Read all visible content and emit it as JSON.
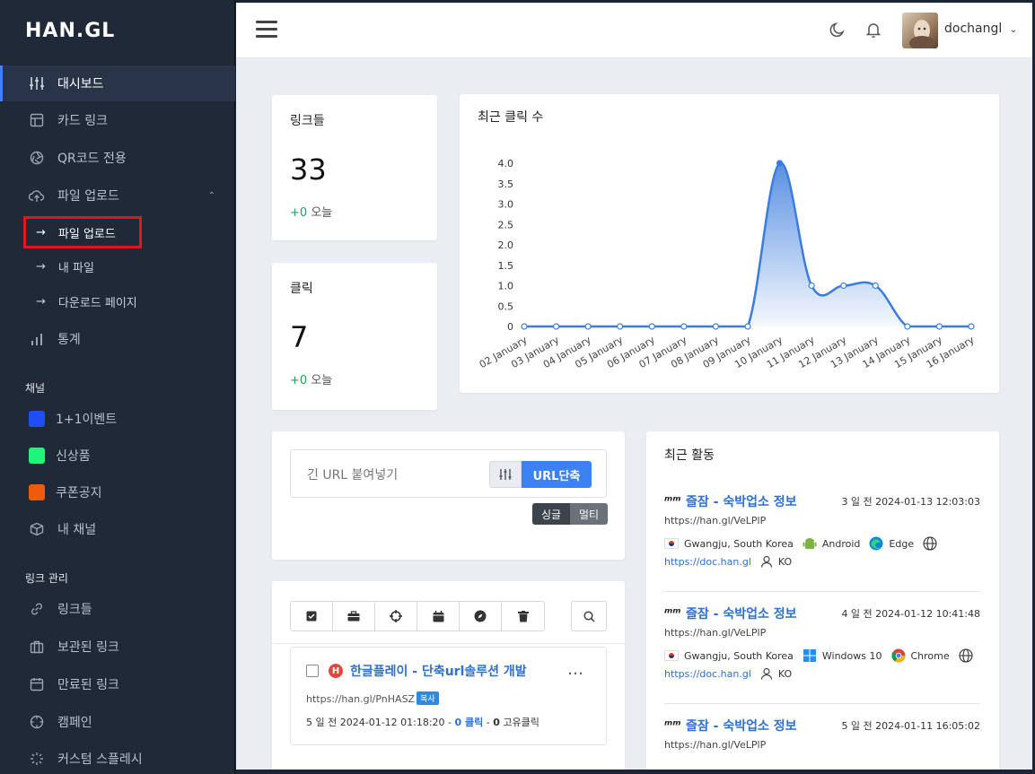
{
  "logo": "HAN.GL",
  "sidebar": {
    "items": [
      {
        "label": "대시보드",
        "icon": "sliders-icon"
      },
      {
        "label": "카드 링크",
        "icon": "layout-icon"
      },
      {
        "label": "QR코드 전용",
        "icon": "aperture-icon"
      },
      {
        "label": "파일 업로드",
        "icon": "upload-cloud-icon"
      }
    ],
    "sub_items": [
      {
        "label": "파일 업로드"
      },
      {
        "label": "내 파일"
      },
      {
        "label": "다운로드 페이지"
      }
    ],
    "stats_label": "통계",
    "channel_title": "채널",
    "channels": [
      {
        "label": "1+1이벤트",
        "color": "#1e4ff5"
      },
      {
        "label": "신상품",
        "color": "#1ef57a"
      },
      {
        "label": "쿠폰공지",
        "color": "#f05a0c"
      }
    ],
    "my_channel": "내 채널",
    "link_mgmt_title": "링크 관리",
    "link_items": [
      {
        "label": "링크들"
      },
      {
        "label": "보관된 링크"
      },
      {
        "label": "만료된 링크"
      },
      {
        "label": "캠페인"
      },
      {
        "label": "커스텀 스플레시"
      }
    ]
  },
  "header": {
    "username": "dochangl"
  },
  "stats": {
    "links": {
      "title": "링크들",
      "value": "33",
      "plus": "+0",
      "today": "오늘"
    },
    "clicks": {
      "title": "클릭",
      "value": "7",
      "plus": "+0",
      "today": "오늘"
    }
  },
  "chart_card_title": "최근 클릭 수",
  "chart_data": {
    "type": "area",
    "title": "최근 클릭 수",
    "categories": [
      "02 January",
      "03 January",
      "04 January",
      "05 January",
      "06 January",
      "07 January",
      "08 January",
      "09 January",
      "10 January",
      "11 January",
      "12 January",
      "13 January",
      "14 January",
      "15 January",
      "16 January"
    ],
    "values": [
      0,
      0,
      0,
      0,
      0,
      0,
      0,
      0,
      4,
      1,
      1,
      1,
      0,
      0,
      0
    ],
    "yticks": [
      "4.0",
      "3.5",
      "3.0",
      "2.5",
      "2.0",
      "1.5",
      "1.0",
      "0.5",
      "0"
    ],
    "ylim": [
      0,
      4
    ],
    "color": "#3b7ddd"
  },
  "shorten": {
    "placeholder": "긴 URL 붙여넣기",
    "button": "URL단축",
    "single": "싱글",
    "multi": "멀티"
  },
  "link_list": {
    "item": {
      "favicon_letter": "H",
      "title": "한글플레이 - 단축url솔루션 개발",
      "short_url": "https://han.gl/PnHASZ",
      "copy": "복사",
      "ago": "5 일 전 2024-01-12 01:18:20 -",
      "clicks_num": "0 클릭",
      "sep": "-",
      "unique_num": "0",
      "unique_label": "고유클릭"
    }
  },
  "activity": {
    "title": "최근 활동",
    "items": [
      {
        "title": "즐잠 - 숙박업소 정보",
        "time": "3 일 전 2024-01-13 12:03:03",
        "url": "https://han.gl/VeLPlP",
        "location": "Gwangju, South Korea",
        "os": "Android",
        "browser": "Edge",
        "referrer": "https://doc.han.gl",
        "lang": "KO"
      },
      {
        "title": "즐잠 - 숙박업소 정보",
        "time": "4 일 전 2024-01-12 10:41:48",
        "url": "https://han.gl/VeLPlP",
        "location": "Gwangju, South Korea",
        "os": "Windows 10",
        "browser": "Chrome",
        "referrer": "https://doc.han.gl",
        "lang": "KO"
      },
      {
        "title": "즐잠 - 숙박업소 정보",
        "time": "5 일 전 2024-01-11 16:05:02",
        "url": "https://han.gl/VeLPlP"
      }
    ]
  }
}
